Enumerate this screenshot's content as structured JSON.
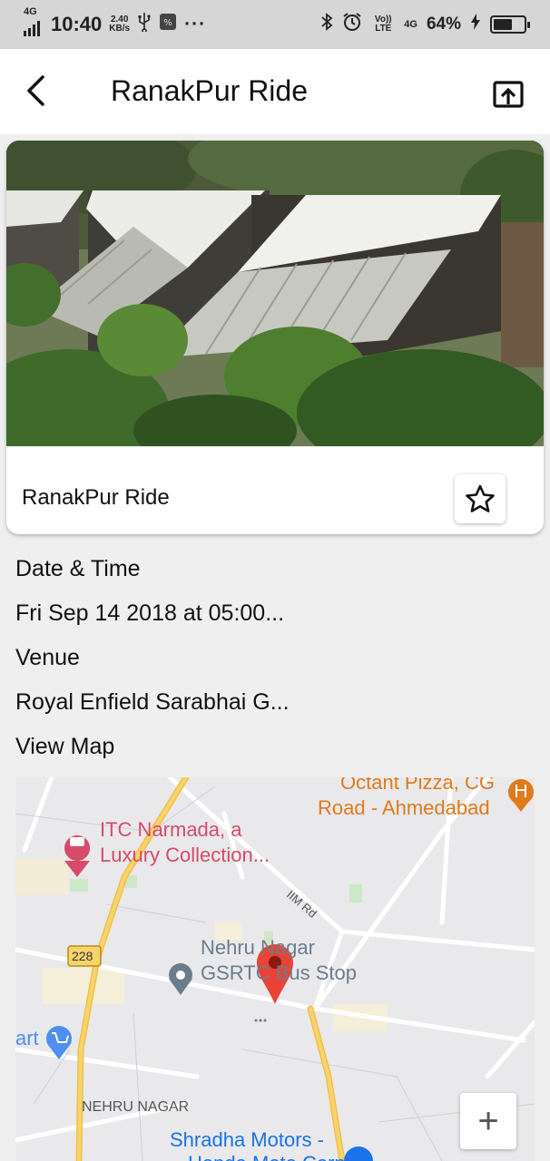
{
  "status_bar": {
    "network_left": "4G",
    "time": "10:40",
    "speed_value": "2.40",
    "speed_unit": "KB/s",
    "more": "···",
    "volte": "Vo)) LTE",
    "network_right": "4G",
    "battery": "64%",
    "battery_level": 0.64,
    "icons": [
      "signal-icon",
      "usb-icon",
      "app-notification-icon",
      "bluetooth-icon",
      "alarm-icon",
      "charging-icon",
      "battery-icon"
    ]
  },
  "app_bar": {
    "title": "RanakPur Ride",
    "back_icon": "back-arrow-icon",
    "share_icon": "share-upload-icon"
  },
  "event": {
    "card_title": "RanakPur Ride",
    "favorite_icon": "star-outline-icon"
  },
  "details": {
    "date_label": "Date & Time",
    "date_value": "Fri Sep 14 2018 at 05:00...",
    "venue_label": "Venue",
    "venue_value": "Royal Enfield Sarabhai G...",
    "map_link": "View Map"
  },
  "map": {
    "labels": {
      "pizza": "Octant Pizza, CG",
      "road": "Road - Ahmedabad",
      "itc1": "ITC Narmada, a",
      "itc2": "Luxury Collection...",
      "iim": "IIM Rd",
      "nehru1": "Nehru Nagar",
      "nehru2": "GSRTC Bus Stop",
      "route": "228",
      "mart": "art",
      "area": "NEHRU NAGAR",
      "shradha": "Shradha Motors -",
      "honda": "Honda Moto Corp"
    },
    "zoom_in": "+",
    "colors": {
      "road_major": "#f7d46b",
      "road_minor": "#ffffff",
      "poi_red": "#d84a6a",
      "poi_orange": "#e07b1a",
      "pin_red": "#ea4335",
      "poi_blue": "#1a73e8",
      "park": "#cde8c8"
    }
  }
}
